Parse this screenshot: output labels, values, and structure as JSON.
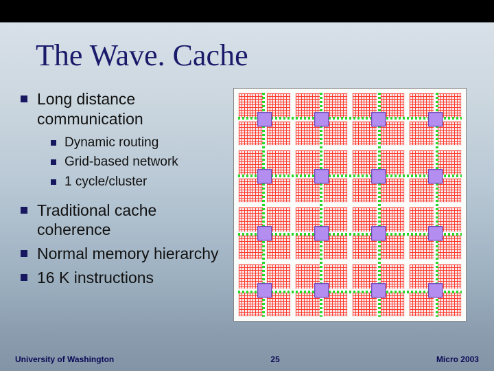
{
  "title": "The Wave. Cache",
  "bullets": {
    "b1": "Long distance communication",
    "sub1": "Dynamic routing",
    "sub2": "Grid-based network",
    "sub3": "1 cycle/cluster",
    "b2": "Traditional cache coherence",
    "b3": "Normal memory hierarchy",
    "b4": "16 K instructions"
  },
  "footer": {
    "left": "University of Washington",
    "page": "25",
    "right": "Micro 2003"
  },
  "diagram": {
    "clusters": 16,
    "tiles_per_cluster": 4,
    "central_block": "switch",
    "link_color": "#27d727",
    "tile_color": "#ff3b2f",
    "switch_color": "#b48df0"
  }
}
